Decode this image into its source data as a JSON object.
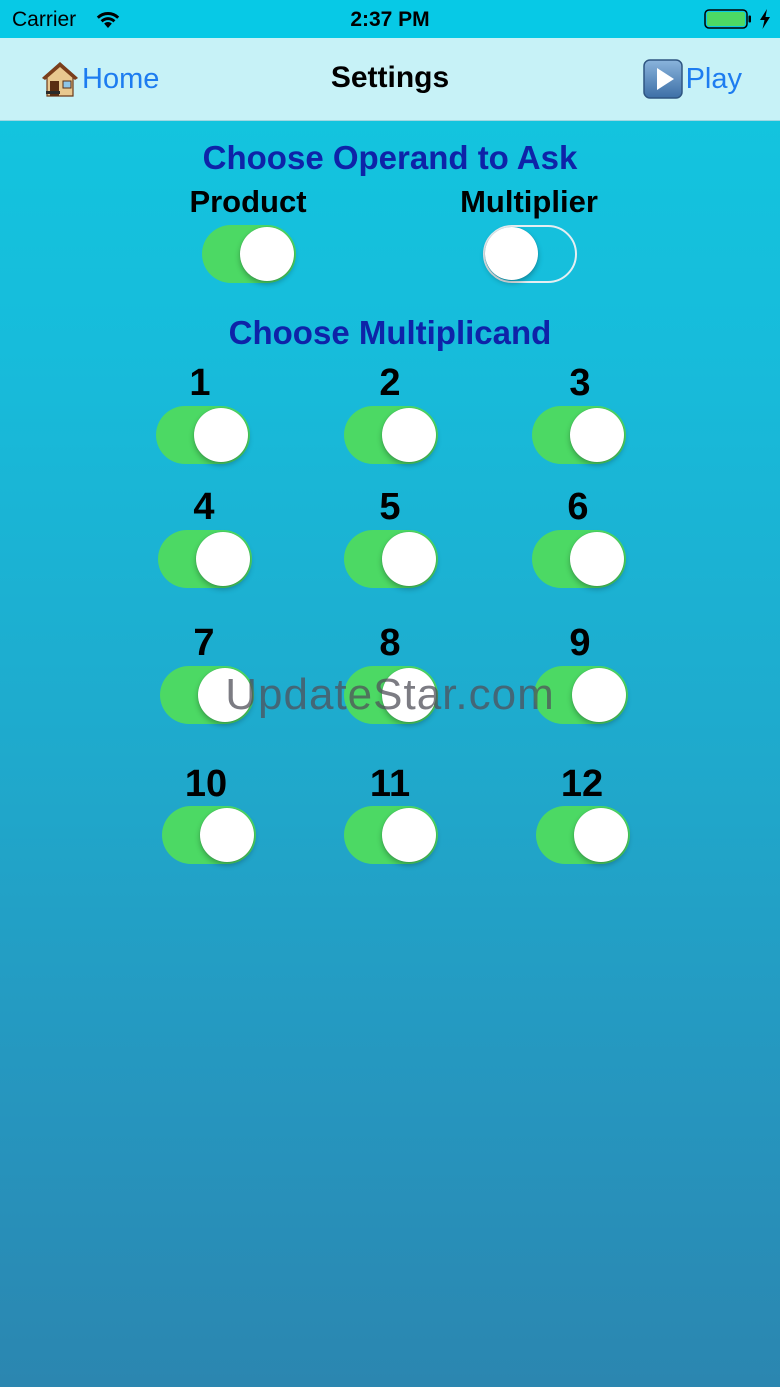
{
  "status_bar": {
    "carrier": "Carrier",
    "time": "2:37 PM",
    "battery_level": 1.0
  },
  "nav": {
    "home_label": "Home",
    "title": "Settings",
    "play_label": "Play"
  },
  "operand_section": {
    "title": "Choose Operand to Ask",
    "options": [
      {
        "label": "Product",
        "on": true
      },
      {
        "label": "Multiplier",
        "on": false
      }
    ]
  },
  "multiplicand_section": {
    "title": "Choose Multiplicand",
    "items": [
      {
        "label": "1",
        "on": true
      },
      {
        "label": "2",
        "on": true
      },
      {
        "label": "3",
        "on": true
      },
      {
        "label": "4",
        "on": true
      },
      {
        "label": "5",
        "on": true
      },
      {
        "label": "6",
        "on": true
      },
      {
        "label": "7",
        "on": true
      },
      {
        "label": "8",
        "on": true
      },
      {
        "label": "9",
        "on": true
      },
      {
        "label": "10",
        "on": true
      },
      {
        "label": "11",
        "on": true
      },
      {
        "label": "12",
        "on": true
      }
    ]
  },
  "watermark": "UpdateStar.com",
  "colors": {
    "toggle_on": "#4cd964",
    "heading": "#0e23a8",
    "link": "#1d7cf0",
    "nav_background": "#c7f2f7"
  }
}
